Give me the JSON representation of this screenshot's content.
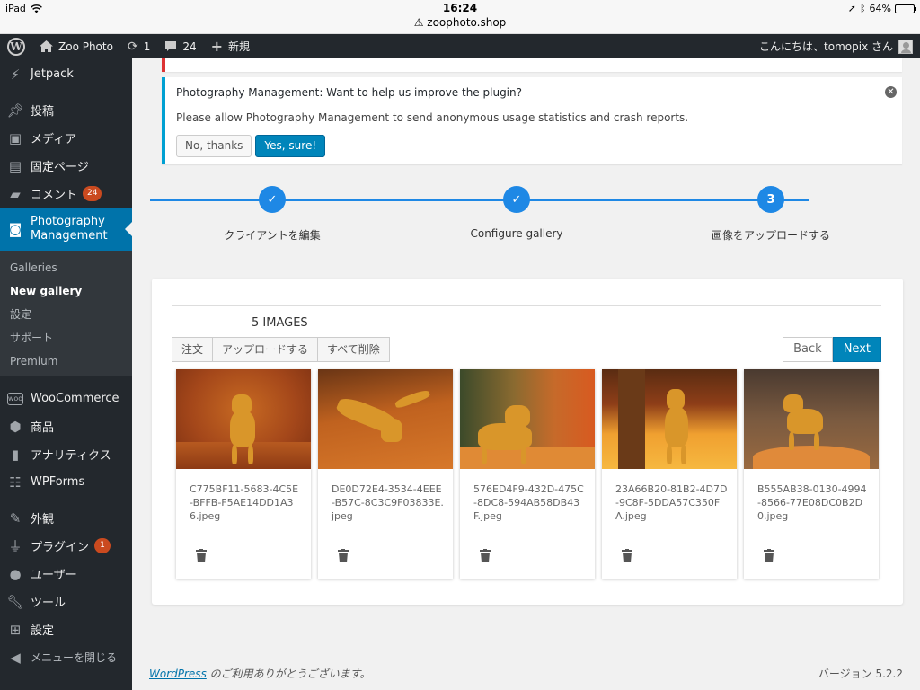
{
  "ios": {
    "device": "iPad",
    "time": "16:24",
    "url": "zoophoto.shop",
    "battery": "64%",
    "battery_level": 0.64
  },
  "adminbar": {
    "site_name": "Zoo Photo",
    "updates": "1",
    "comments": "24",
    "new_label": "新規",
    "greeting": "こんにちは、tomopix さん"
  },
  "sidebar": {
    "items_top": [
      {
        "label": "Jetpack",
        "icon": "jetpack-icon"
      }
    ],
    "items_main": [
      {
        "label": "投稿",
        "icon": "pin-icon"
      },
      {
        "label": "メディア",
        "icon": "media-icon"
      },
      {
        "label": "固定ページ",
        "icon": "page-icon"
      },
      {
        "label": "コメント",
        "icon": "comment-icon",
        "badge": "24"
      }
    ],
    "current": {
      "label": "Photography Management",
      "icon": "camera-icon"
    },
    "submenu": [
      "Galleries",
      "New gallery",
      "設定",
      "サポート",
      "Premium"
    ],
    "submenu_active": "New gallery",
    "items_woo": [
      {
        "label": "WooCommerce",
        "icon": "woo-icon"
      },
      {
        "label": "商品",
        "icon": "box-icon"
      },
      {
        "label": "アナリティクス",
        "icon": "chart-icon"
      },
      {
        "label": "WPForms",
        "icon": "forms-icon"
      }
    ],
    "items_bottom": [
      {
        "label": "外観",
        "icon": "brush-icon"
      },
      {
        "label": "プラグイン",
        "icon": "plugin-icon",
        "badge": "1"
      },
      {
        "label": "ユーザー",
        "icon": "user-icon"
      },
      {
        "label": "ツール",
        "icon": "wrench-icon"
      },
      {
        "label": "設定",
        "icon": "settings-icon"
      },
      {
        "label": "メニューを閉じる",
        "icon": "collapse-icon"
      }
    ]
  },
  "notice": {
    "plugin": "Photography Management",
    "question": ": Want to help us improve the plugin?",
    "message": "Please allow Photography Management to send anonymous usage statistics and crash reports.",
    "no_label": "No, thanks",
    "yes_label": "Yes, sure!"
  },
  "stepper": {
    "steps": [
      {
        "label": "クライアントを編集",
        "state": "done"
      },
      {
        "label": "Configure gallery",
        "state": "done"
      },
      {
        "label": "画像をアップロードする",
        "state": "current",
        "number": "3"
      }
    ]
  },
  "gallery": {
    "count_label": "5 IMAGES",
    "toolbar": [
      "注文",
      "アップロードする",
      "すべて削除"
    ],
    "back_label": "Back",
    "next_label": "Next",
    "images": [
      {
        "filename": "C775BF11-5683-4C5E-BFFB-F5AE14DD1A36.jpeg"
      },
      {
        "filename": "DE0D72E4-3534-4EEE-B57C-8C3C9F03833E.jpeg"
      },
      {
        "filename": "576ED4F9-432D-475C-8DC8-594AB58DB43F.jpeg"
      },
      {
        "filename": "23A66B20-81B2-4D7D-9C8F-5DDA57C350FA.jpeg"
      },
      {
        "filename": "B555AB38-0130-4994-8566-77E08DC0B2D0.jpeg"
      }
    ]
  },
  "footer": {
    "link": "WordPress",
    "thanks": " のご利用ありがとうございます。",
    "version": "バージョン 5.2.2"
  }
}
